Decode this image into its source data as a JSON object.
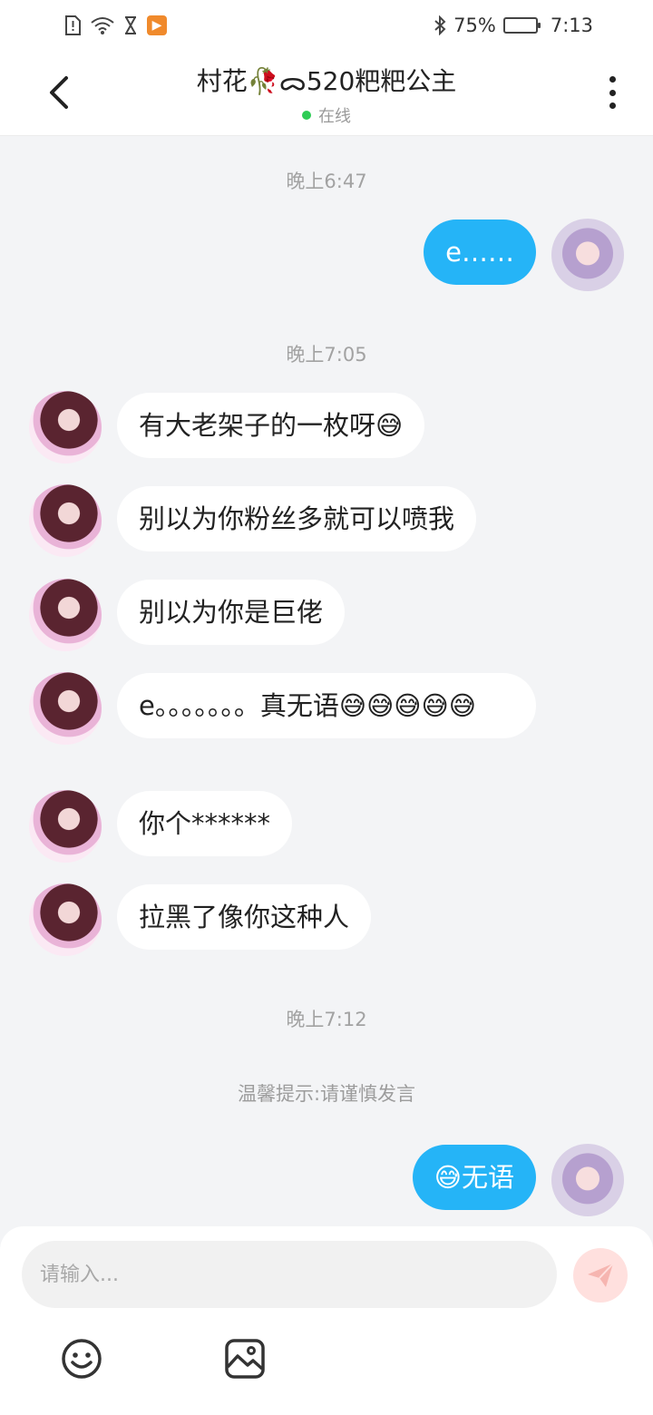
{
  "status_bar": {
    "battery": "75%",
    "time": "7:13",
    "battery_level": 0.75,
    "icons": [
      "alert-card-icon",
      "wifi-icon",
      "hourglass-icon",
      "app-play-icon",
      "bluetooth-icon",
      "battery-icon"
    ]
  },
  "header": {
    "title": "村花🥀ᯅ520粑粑公主",
    "status": "在线"
  },
  "chat": {
    "times": [
      "晚上6:47",
      "晚上7:05",
      "晚上7:12"
    ],
    "messages": [
      {
        "from": "self",
        "text": "e……"
      },
      {
        "from": "other",
        "text": "有大老架子的一枚呀😅"
      },
      {
        "from": "other",
        "text": "别以为你粉丝多就可以喷我"
      },
      {
        "from": "other",
        "text": "别以为你是巨佬"
      },
      {
        "from": "other",
        "text": "e。。。。。。。真无语😅😅😅😅😅"
      },
      {
        "from": "other",
        "text": "你个******"
      },
      {
        "from": "other",
        "text": "拉黑了像你这种人"
      },
      {
        "from": "self",
        "text": "😅无语"
      }
    ],
    "notice": "温馨提示:请谨慎发言"
  },
  "input": {
    "placeholder": "请输入..."
  },
  "colors": {
    "self_bubble": "#25b4f7",
    "other_bubble": "#ffffff",
    "background": "#f3f4f6",
    "online_dot": "#2ecc55",
    "send_button": "#ffe0de",
    "send_icon": "#f6b5b0"
  }
}
